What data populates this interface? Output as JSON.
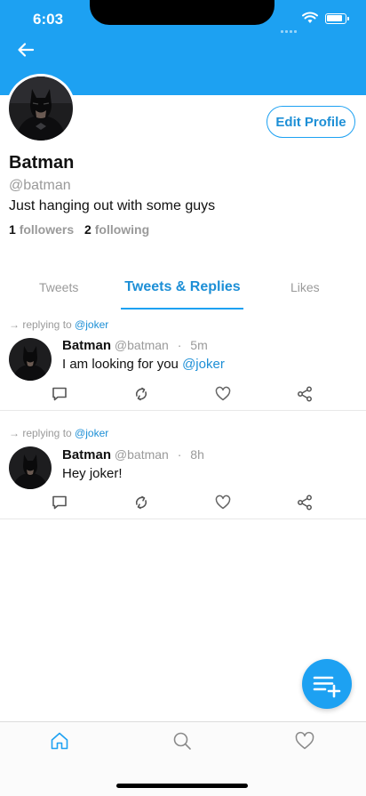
{
  "status_bar": {
    "time": "6:03"
  },
  "profile": {
    "name": "Batman",
    "handle": "@batman",
    "bio": "Just hanging out with some guys",
    "followers_count": "1",
    "followers_label": "followers",
    "following_count": "2",
    "following_label": "following",
    "edit_label": "Edit Profile"
  },
  "tabs": [
    {
      "label": "Tweets",
      "active": false
    },
    {
      "label": "Tweets & Replies",
      "active": true
    },
    {
      "label": "Likes",
      "active": false
    }
  ],
  "tweets": [
    {
      "reply_prefix": "→ replying to",
      "reply_to": "@joker",
      "author": "Batman",
      "handle": "@batman",
      "dot": "·",
      "time": "5m",
      "text": "I am looking for you",
      "text_mention": "@joker"
    },
    {
      "reply_prefix": "→ replying to",
      "reply_to": "@joker",
      "author": "Batman",
      "handle": "@batman",
      "dot": "·",
      "time": "8h",
      "text": "Hey joker!",
      "text_mention": ""
    }
  ],
  "icons": {
    "back": "arrow-left-icon",
    "reply": "comment-icon",
    "retweet": "retweet-icon",
    "like": "heart-icon",
    "share": "share-icon",
    "compose": "compose-tweet-icon",
    "nav": [
      "home-icon",
      "search-icon",
      "heart-icon"
    ]
  },
  "colors": {
    "brand": "#1da1f2",
    "link": "#1d8fd6",
    "muted": "#9a9a9a"
  }
}
